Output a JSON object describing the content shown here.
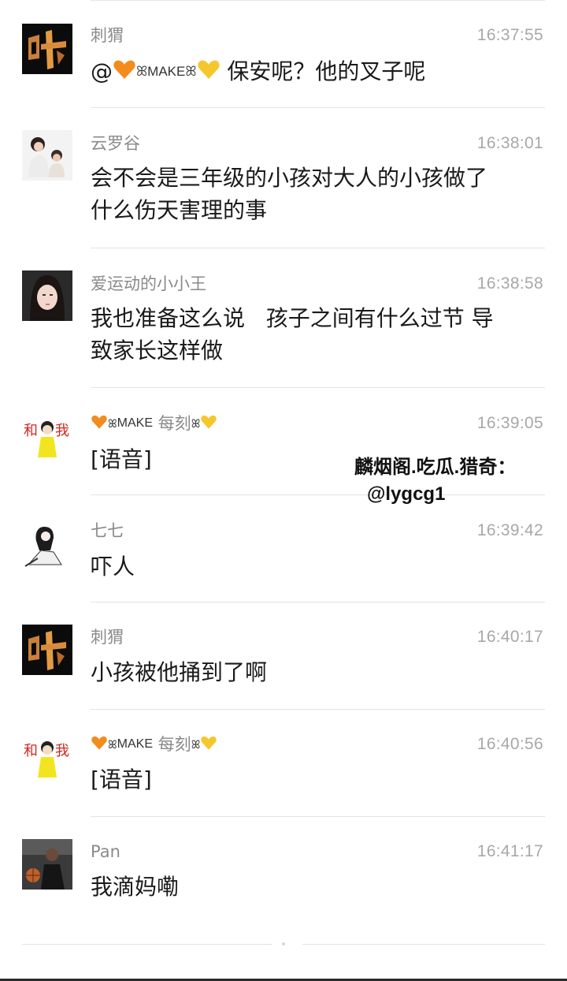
{
  "messages": [
    {
      "sender": "刺猬",
      "time": "16:37:55",
      "lines": [
        "@🧡 MAKE 💛 保安呢？他的叉子呢"
      ],
      "mention_prefix": "@",
      "mention_name": "MAKE",
      "body_rest": "保安呢？他的叉子呢"
    },
    {
      "sender": "云罗谷",
      "time": "16:38:01",
      "lines": [
        "会不会是三年级的小孩对大人的小孩做了",
        "什么伤天害理的事"
      ]
    },
    {
      "sender": "爱运动的小小王",
      "time": "16:38:58",
      "lines": [
        "我也准备这么说   孩子之间有什么过节 导",
        "致家长这样做"
      ]
    },
    {
      "sender_name": "MAKE",
      "sender_suffix": "每刻",
      "time": "16:39:05",
      "lines": [
        "[语音]"
      ]
    },
    {
      "sender": "七七",
      "time": "16:39:42",
      "lines": [
        "吓人"
      ]
    },
    {
      "sender": "刺猬",
      "time": "16:40:17",
      "lines": [
        "小孩被他捅到了啊"
      ]
    },
    {
      "sender_name": "MAKE",
      "sender_suffix": "每刻",
      "time": "16:40:56",
      "lines": [
        "[语音]"
      ]
    },
    {
      "sender": "Pan",
      "time": "16:41:17",
      "lines": [
        "我滴妈嘞"
      ]
    }
  ],
  "watermark": {
    "line1": "麟烟阁.吃瓜.猎奇：",
    "line2": "@lygcg1"
  },
  "icons": {
    "orange_heart": "orange-heart-icon",
    "yellow_heart": "yellow-heart-icon",
    "bow": "bow-icon"
  }
}
